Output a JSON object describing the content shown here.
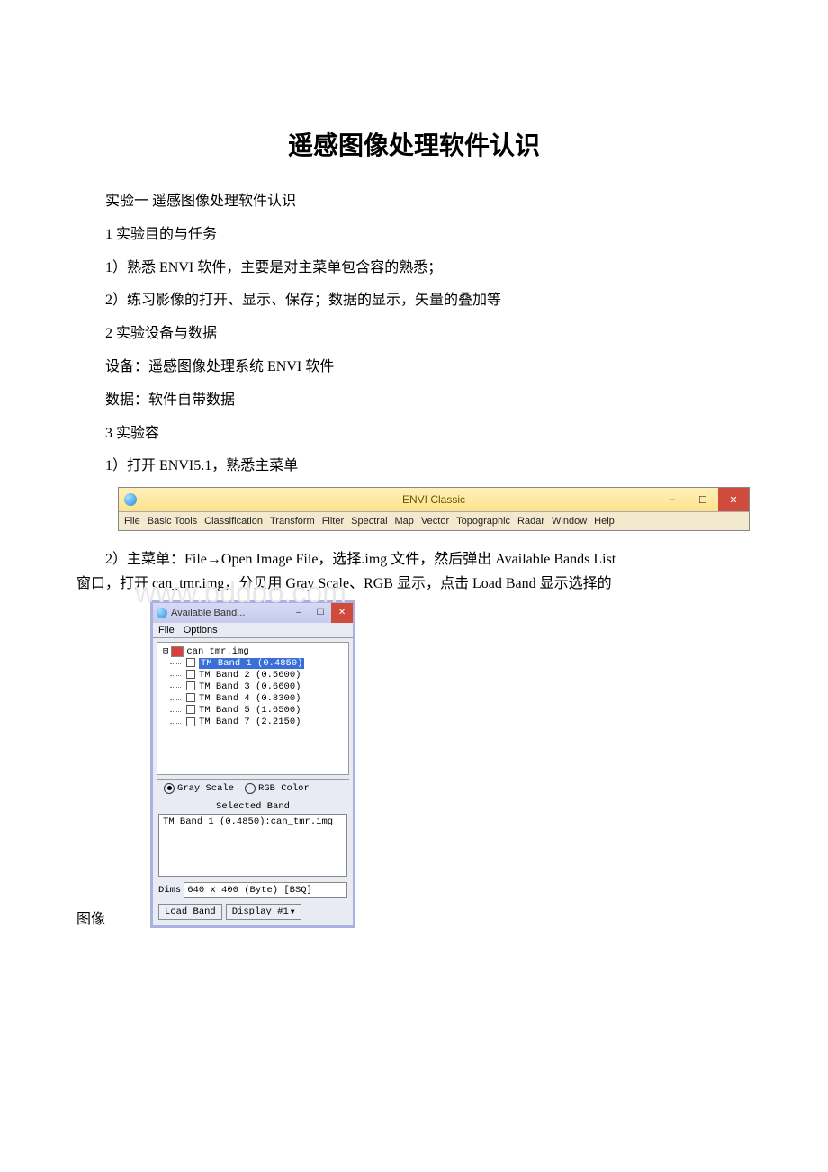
{
  "title": "遥感图像处理软件认识",
  "paras": {
    "p1": "实验一 遥感图像处理软件认识",
    "p2": "1 实验目的与任务",
    "p3": "1）熟悉 ENVI 软件，主要是对主菜单包含容的熟悉；",
    "p4": " 2）练习影像的打开、显示、保存；数据的显示，矢量的叠加等",
    "p5": "2 实验设备与数据",
    "p6": "设备：遥感图像处理系统 ENVI 软件",
    "p7": "数据：软件自带数据",
    "p8": "3 实验容",
    "p9": "1）打开 ENVI5.1，熟悉主菜单",
    "p10a": "2）主菜单：File→Open Image File，选择.img 文件，然后弹出 Available Bands List",
    "p10b": "窗口，打开 can_tmr.img，分贝用 Gray Scale、RGB 显示，点击 Load Band 显示选择的",
    "fig_label": "图像"
  },
  "watermark": "www.bdddo.com",
  "envi": {
    "title": "ENVI Classic",
    "menus": [
      "File",
      "Basic Tools",
      "Classification",
      "Transform",
      "Filter",
      "Spectral",
      "Map",
      "Vector",
      "Topographic",
      "Radar",
      "Window",
      "Help"
    ]
  },
  "avail": {
    "title": "Available Band...",
    "menus": [
      "File",
      "Options"
    ],
    "root": "can_tmr.img",
    "bands": [
      "TM Band 1 (0.4850)",
      "TM Band 2 (0.5600)",
      "TM Band 3 (0.6600)",
      "TM Band 4 (0.8300)",
      "TM Band 5 (1.6500)",
      "TM Band 7 (2.2150)"
    ],
    "gray": "Gray Scale",
    "rgb": "RGB Color",
    "sel_label": "Selected Band",
    "sel_value": "TM Band 1 (0.4850):can_tmr.img",
    "dims_label": "Dims",
    "dims_value": "640 x 400 (Byte) [BSQ]",
    "load": "Load Band",
    "display": "Display #1"
  }
}
